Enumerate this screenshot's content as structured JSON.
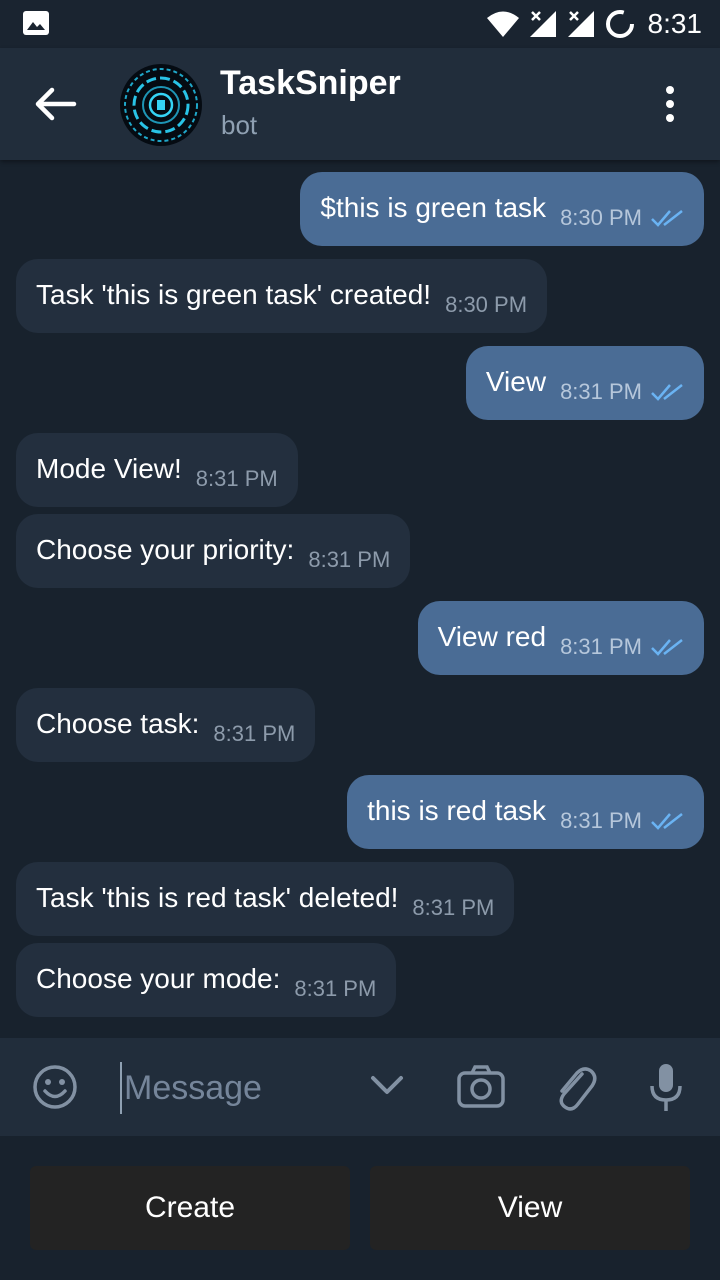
{
  "status_bar": {
    "time": "8:31"
  },
  "header": {
    "title": "TaskSniper",
    "subtitle": "bot"
  },
  "messages": [
    {
      "direction": "out",
      "text": "$this is green task",
      "time": "8:30 PM"
    },
    {
      "direction": "in",
      "text": "Task 'this is green task' created!",
      "time": "8:30 PM"
    },
    {
      "direction": "out",
      "text": "View",
      "time": "8:31 PM"
    },
    {
      "direction": "in",
      "text": "Mode View!",
      "time": "8:31 PM"
    },
    {
      "direction": "in",
      "text": "Choose your priority:",
      "time": "8:31 PM"
    },
    {
      "direction": "out",
      "text": "View red",
      "time": "8:31 PM"
    },
    {
      "direction": "in",
      "text": "Choose task:",
      "time": "8:31 PM"
    },
    {
      "direction": "out",
      "text": "this is red task",
      "time": "8:31 PM"
    },
    {
      "direction": "in",
      "text": "Task 'this is red task' deleted!",
      "time": "8:31 PM"
    },
    {
      "direction": "in",
      "text": "Choose your mode:",
      "time": "8:31 PM"
    }
  ],
  "composer": {
    "placeholder": "Message"
  },
  "keyboard": {
    "buttons": [
      "Create",
      "View"
    ]
  },
  "colors": {
    "outgoing_bubble": "#4a6c95",
    "incoming_bubble": "#232f3e",
    "background": "#18222d",
    "header": "#212d3b",
    "read_ticks": "#6ab3f3"
  }
}
